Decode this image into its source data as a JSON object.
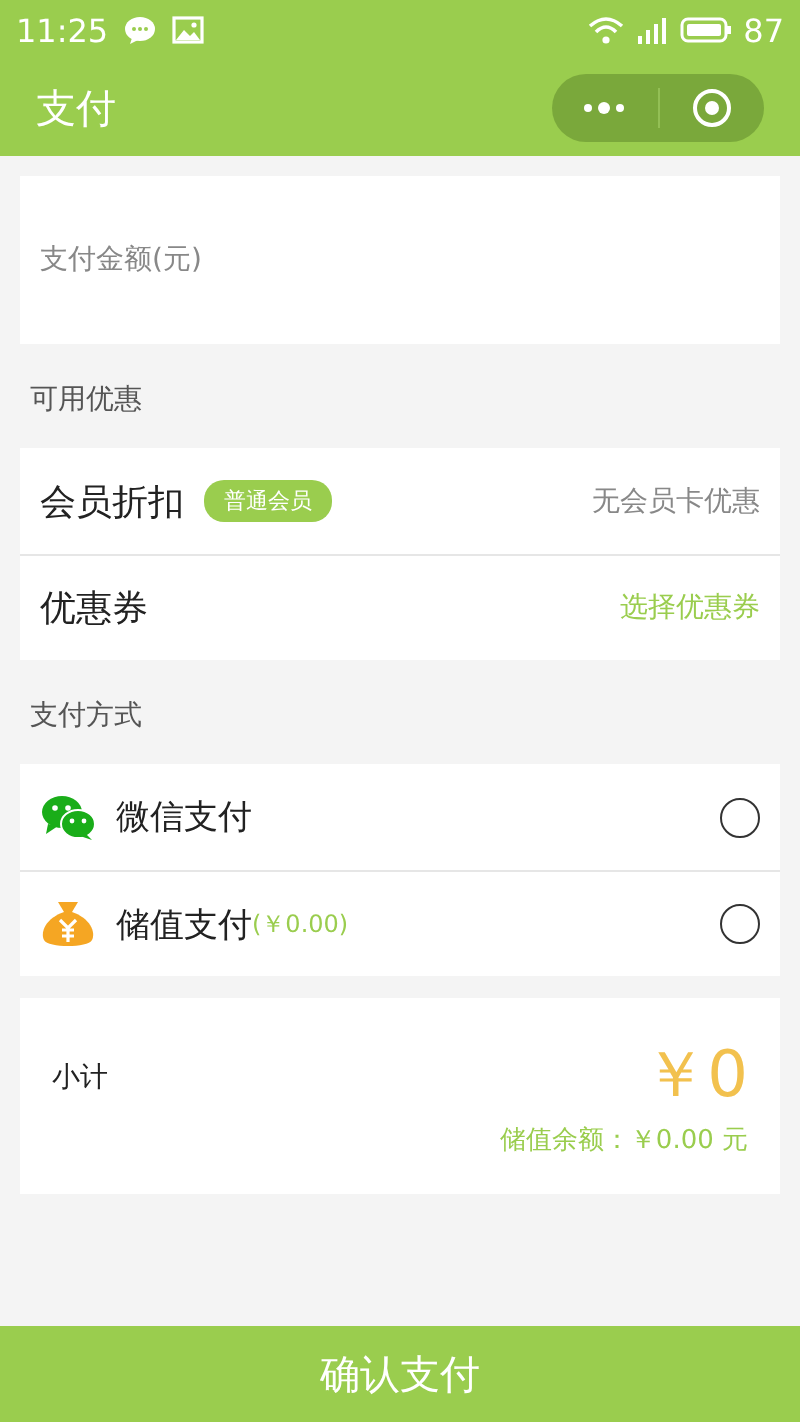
{
  "status_bar": {
    "time": "11:25",
    "battery": "87"
  },
  "nav": {
    "title": "支付"
  },
  "amount_field": {
    "placeholder": "支付金额(元)"
  },
  "discounts": {
    "heading": "可用优惠",
    "rows": [
      {
        "kind": "member",
        "label": "会员折扣",
        "badge": "普通会员",
        "value": "无会员卡优惠"
      },
      {
        "kind": "coupon",
        "label": "优惠券",
        "value": "选择优惠券"
      }
    ]
  },
  "payment": {
    "heading": "支付方式",
    "methods": [
      {
        "kind": "wechat",
        "label": "微信支付",
        "selected": false
      },
      {
        "kind": "stored",
        "label": "储值支付",
        "note": "(￥0.00)",
        "selected": false
      }
    ]
  },
  "summary": {
    "label": "小计",
    "total": "￥0",
    "balance": "储值余额：￥0.00 元"
  },
  "confirm_button": "确认支付"
}
